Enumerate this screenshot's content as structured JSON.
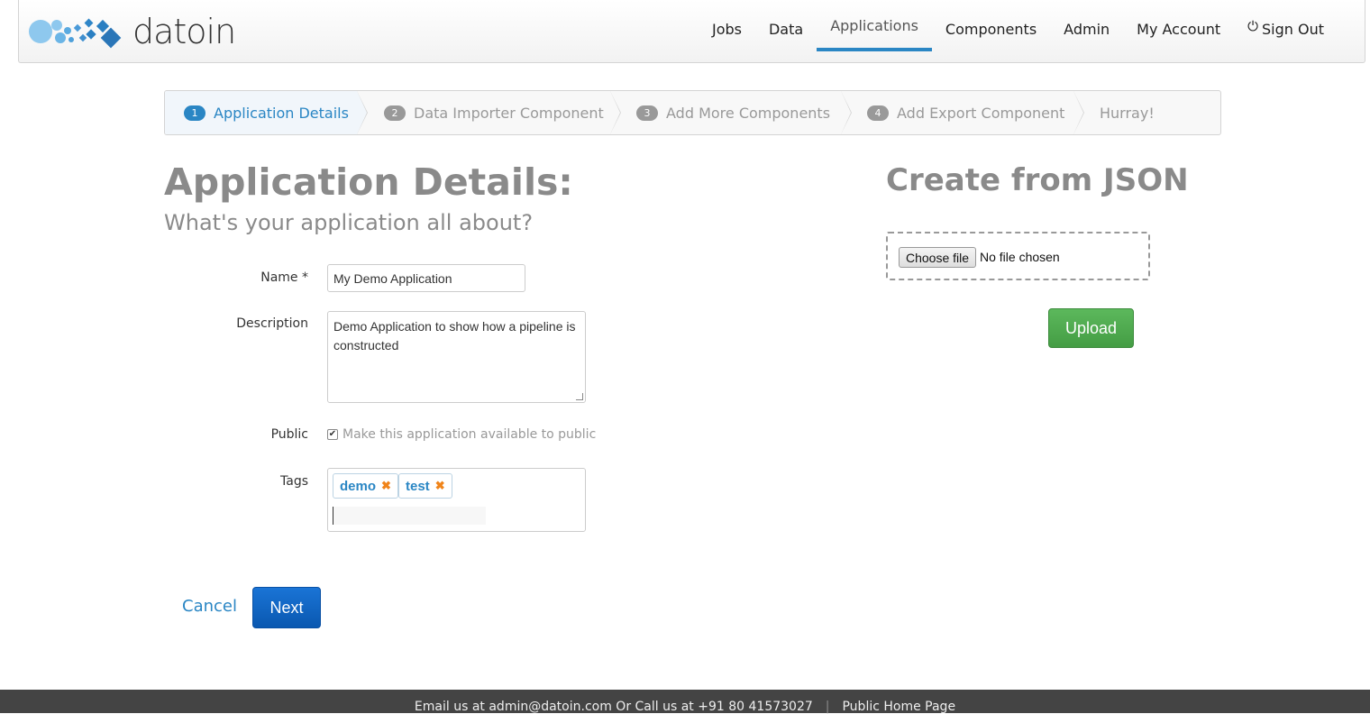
{
  "brand": {
    "name": "datoin",
    "logo_icon": "bubbles-diamonds-logo",
    "accent_color": "#2a86c4"
  },
  "nav": {
    "items": [
      {
        "label": "Jobs"
      },
      {
        "label": "Data"
      },
      {
        "label": "Applications",
        "active": true
      },
      {
        "label": "Components"
      },
      {
        "label": "Admin"
      },
      {
        "label": "My Account"
      },
      {
        "label": "Sign Out",
        "icon": "power-icon"
      }
    ]
  },
  "wizard": {
    "steps": [
      {
        "num": "1",
        "label": "Application Details",
        "active": true
      },
      {
        "num": "2",
        "label": "Data Importer Component"
      },
      {
        "num": "3",
        "label": "Add More Components"
      },
      {
        "num": "4",
        "label": "Add Export Component"
      },
      {
        "num": "",
        "label": "Hurray!"
      }
    ]
  },
  "form": {
    "title": "Application Details:",
    "subtitle": "What's your application all about?",
    "name_label": "Name *",
    "name_value": "My Demo Application",
    "description_label": "Description",
    "description_value": "Demo Application to show how a pipeline is constructed",
    "public_label": "Public",
    "public_checked": true,
    "public_text": "Make this application available to public",
    "tags_label": "Tags",
    "tags": [
      "demo",
      "test"
    ],
    "cancel_label": "Cancel",
    "next_label": "Next"
  },
  "json_upload": {
    "title": "Create from JSON",
    "choose_file_label": "Choose file",
    "no_file_text": "No file chosen",
    "upload_label": "Upload"
  },
  "footer": {
    "contact_text": "Email us at admin@datoin.com Or Call us at +91 80 41573027",
    "separator": "|",
    "home_link": "Public Home Page"
  }
}
